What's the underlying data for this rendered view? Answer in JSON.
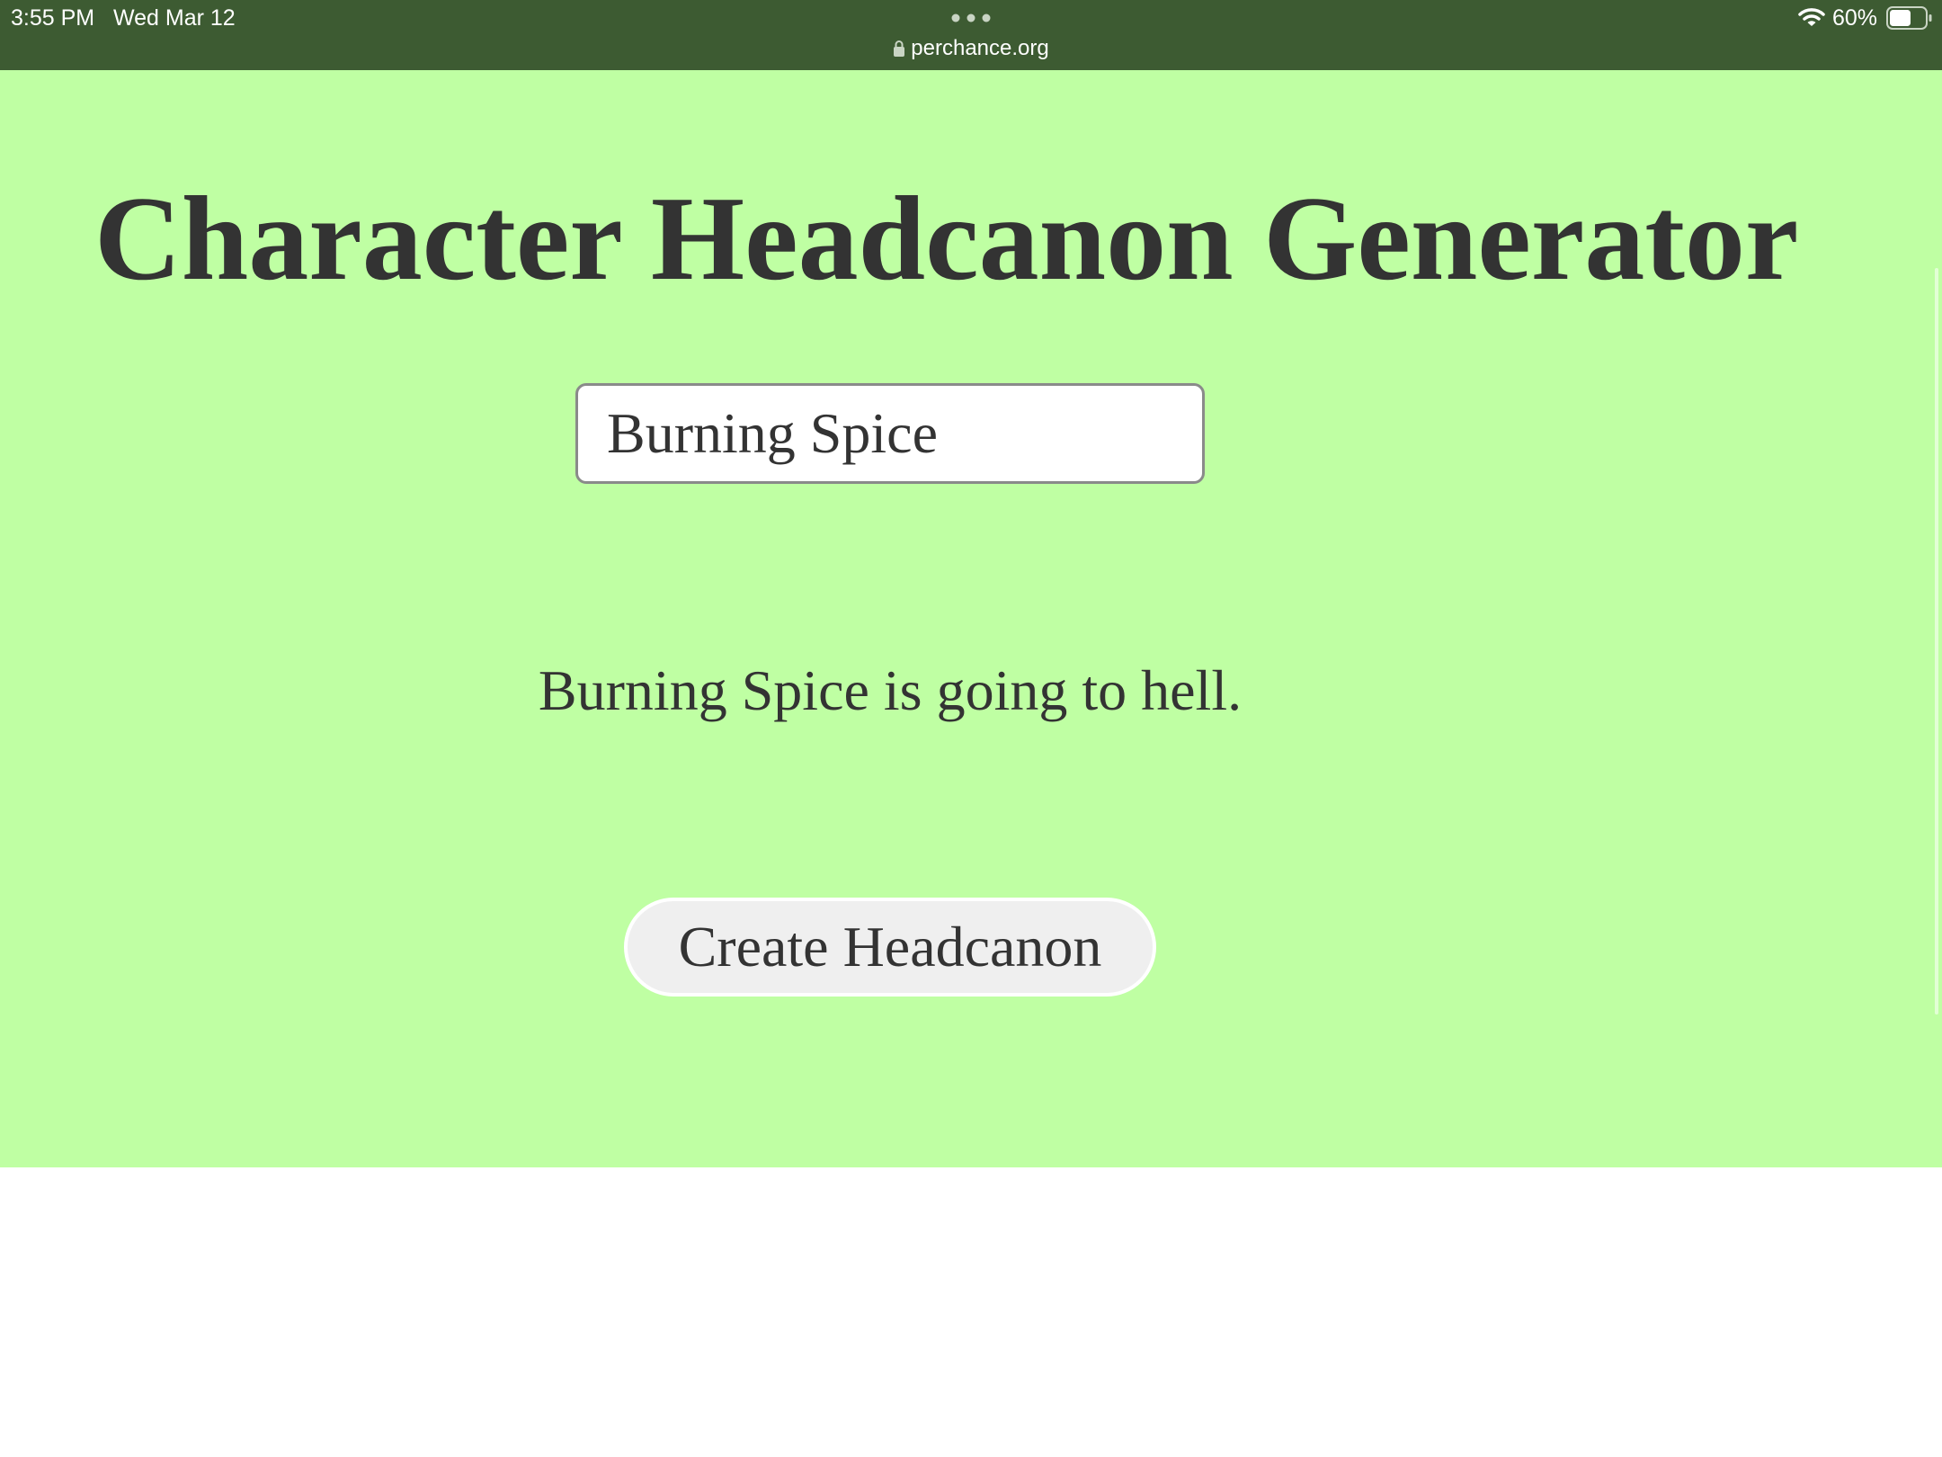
{
  "status_bar": {
    "time": "3:55 PM",
    "date": "Wed Mar 12",
    "url": "perchance.org",
    "battery_percent": "60%",
    "battery_level": 0.6,
    "icons": [
      "lock-icon",
      "wifi-icon",
      "battery-icon",
      "more-dots-icon"
    ]
  },
  "generator": {
    "title": "Character Headcanon Generator",
    "name_input_value": "Burning Spice",
    "output_text": "Burning Spice is going to hell.",
    "button_label": "Create Headcanon"
  },
  "colors": {
    "status_bar_bg": "#3d5b32",
    "page_bg": "#bfffa3",
    "text": "#333333",
    "button_bg": "#efefef"
  }
}
